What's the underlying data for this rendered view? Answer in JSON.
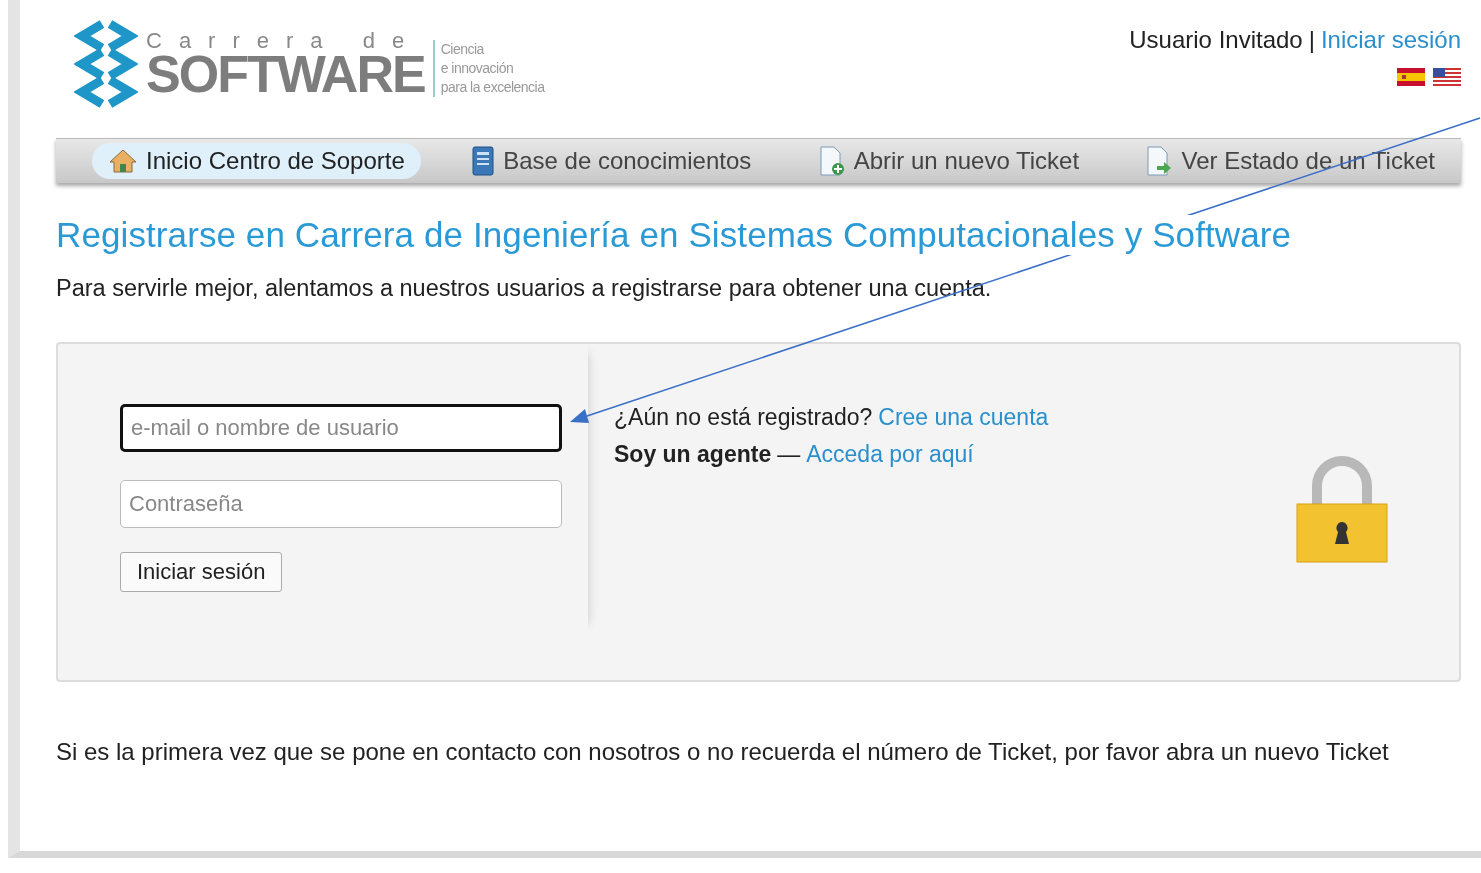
{
  "logo": {
    "line_1": "Carrera de",
    "line_2": "SOFTWARE",
    "tagline": [
      "Ciencia",
      "e innovación",
      "para la excelencia"
    ]
  },
  "user_bar": {
    "user": "Usuario Invitado",
    "separator": "|",
    "login_link": "Iniciar sesión"
  },
  "nav": [
    {
      "label": "Inicio Centro de Soporte",
      "selected": true
    },
    {
      "label": "Base de conocimientos",
      "selected": false
    },
    {
      "label": "Abrir un nuevo Ticket",
      "selected": false
    },
    {
      "label": "Ver Estado de un Ticket",
      "selected": false
    }
  ],
  "title": "Registrarse en Carrera de Ingeniería en Sistemas Computacionales y Software",
  "intro": "Para servirle mejor, alentamos a nuestros usuarios a registrarse para obtener una cuenta.",
  "login_form": {
    "username": {
      "placeholder": "e-mail o nombre de usuario",
      "focused": true
    },
    "password": {
      "placeholder": "Contraseña",
      "focused": false
    },
    "submit": "Iniciar sesión"
  },
  "register": {
    "question": "¿Aún no está registrado?",
    "link": "Cree una cuenta"
  },
  "agent": {
    "label": "Soy un agente",
    "dash": "—",
    "link": "Acceda por aquí"
  },
  "footer_note": "Si es la primera vez que se pone en contacto con nosotros o no recuerda el número de Ticket, por favor abra un nuevo Ticket"
}
